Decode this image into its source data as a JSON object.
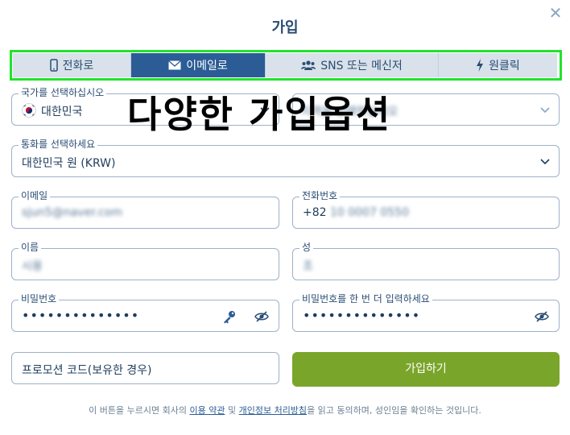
{
  "dialog": {
    "title": "가입",
    "close_icon": "close-icon"
  },
  "tabs": [
    {
      "label": "전화로",
      "icon": "phone-icon"
    },
    {
      "label": "이메일로",
      "icon": "envelope-icon",
      "active": true
    },
    {
      "label": "SNS 또는 메신저",
      "icon": "users-icon"
    },
    {
      "label": "원클릭",
      "icon": "lightning-icon"
    }
  ],
  "form": {
    "country": {
      "label": "국가를 선택하십시오",
      "value": "대한민국"
    },
    "region": {
      "placeholder": "지역을 선택하십시오"
    },
    "currency": {
      "label": "통화를 선택하세요",
      "value": "대한민국 원 (KRW)"
    },
    "email": {
      "label": "이메일",
      "value": "sjun5@naver.com"
    },
    "phone": {
      "label": "전화번호",
      "prefix": "+82",
      "value": "10 0007 0550"
    },
    "first_name": {
      "label": "이름",
      "value": "시용"
    },
    "last_name": {
      "label": "성",
      "value": "조"
    },
    "password": {
      "label": "비밀번호",
      "value": "••••••••••••••"
    },
    "password_confirm": {
      "label": "비밀번호를 한 번 더 입력하세요",
      "value": "••••••••••••••"
    },
    "promo": {
      "placeholder": "프로모션 코드(보유한 경우)"
    },
    "submit_label": "가입하기"
  },
  "overlay_caption": "다양한 가입옵션",
  "terms": {
    "prefix": "이 버튼을 누르시면 회사의 ",
    "link_terms": "이용 약관",
    "and": " 및 ",
    "link_privacy": "개인정보 처리방침",
    "suffix": "을 읽고 동의하며, 성인임을 확인하는 것입니다."
  },
  "colors": {
    "accent": "#2b5c95",
    "submit": "#7aa52b",
    "highlight_border": "#22e32c"
  }
}
